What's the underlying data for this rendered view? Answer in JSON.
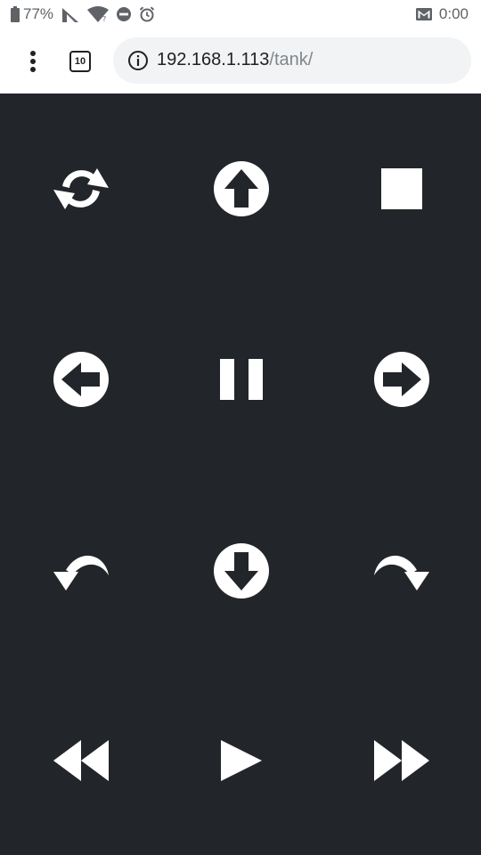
{
  "status_bar": {
    "battery_percent": "77%",
    "time": "0:00",
    "icons": [
      "battery-icon",
      "cell-signal-icon",
      "wifi-icon",
      "do-not-disturb-icon",
      "alarm-icon",
      "gmail-icon"
    ]
  },
  "browser": {
    "tab_count": "10",
    "url_host": "192.168.1.113",
    "url_path": "/tank/"
  },
  "controls": [
    {
      "name": "refresh-button",
      "icon": "refresh-icon"
    },
    {
      "name": "forward-button",
      "icon": "arrow-up-circle-icon"
    },
    {
      "name": "stop-button",
      "icon": "stop-icon"
    },
    {
      "name": "left-button",
      "icon": "arrow-left-circle-icon"
    },
    {
      "name": "pause-button",
      "icon": "pause-icon"
    },
    {
      "name": "right-button",
      "icon": "arrow-right-circle-icon"
    },
    {
      "name": "rotate-left-button",
      "icon": "curved-arrow-left-icon"
    },
    {
      "name": "backward-button",
      "icon": "arrow-down-circle-icon"
    },
    {
      "name": "rotate-right-button",
      "icon": "curved-arrow-right-icon"
    },
    {
      "name": "rewind-button",
      "icon": "rewind-icon"
    },
    {
      "name": "play-button",
      "icon": "play-icon"
    },
    {
      "name": "fast-forward-button",
      "icon": "fast-forward-icon"
    }
  ],
  "colors": {
    "background": "#22252a",
    "icon": "#ffffff",
    "toolbar": "#ffffff",
    "omnibox": "#f1f3f4"
  }
}
